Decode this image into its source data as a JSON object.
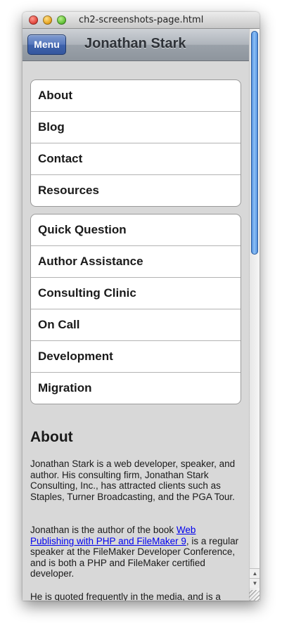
{
  "window": {
    "title": "ch2-screenshots-page.html"
  },
  "toolbar": {
    "menu_label": "Menu",
    "title": "Jonathan Stark"
  },
  "nav_group_1": [
    "About",
    "Blog",
    "Contact",
    "Resources"
  ],
  "nav_group_2": [
    "Quick Question",
    "Author Assistance",
    "Consulting Clinic",
    "On Call",
    "Development",
    "Migration"
  ],
  "about": {
    "heading": "About",
    "p1": "Jonathan Stark is a web developer, speaker, and author. His consulting firm, Jonathan Stark Consulting, Inc., has attracted clients such as Staples, Turner Broadcasting, and the PGA Tour.",
    "p2_before": "Jonathan is the author of the book ",
    "p2_link": "Web Publishing with PHP and FileMaker 9",
    "p2_after": ", is a regular speaker at the FileMaker Developer Conference, and is both a PHP and FileMaker certified developer.",
    "p3": "He is quoted frequently in the media, and is a technical editor for both phplarchitect and"
  },
  "scrollbar": {
    "up_icon": "up-arrow-icon",
    "down_icon": "down-arrow-icon"
  }
}
